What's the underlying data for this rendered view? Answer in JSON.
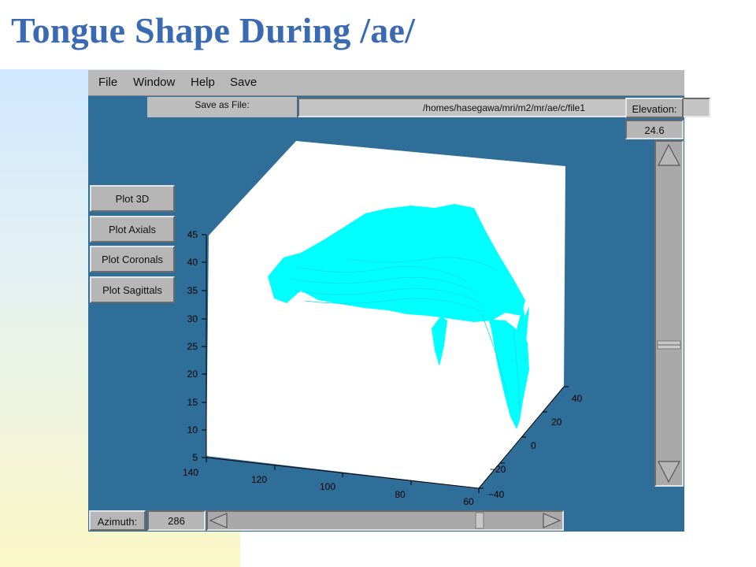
{
  "slide": {
    "title": "Tongue Shape During /ae/"
  },
  "menu": {
    "file": "File",
    "window": "Window",
    "help": "Help",
    "save": "Save"
  },
  "save_as": {
    "label": "Save as File:",
    "path": "/homes/hasegawa/mri/m2/mr/ae/c/file1"
  },
  "elevation": {
    "label": "Elevation:",
    "value": "24.6"
  },
  "azimuth": {
    "label": "Azimuth:",
    "value": "286"
  },
  "buttons": [
    "Plot 3D",
    "Plot Axials",
    "Plot Coronals",
    "Plot Sagittals"
  ],
  "axes": {
    "z_ticks": [
      "45",
      "40",
      "35",
      "30",
      "25",
      "20",
      "15",
      "10",
      "5"
    ],
    "x_ticks": [
      "140",
      "120",
      "100",
      "80",
      "60"
    ],
    "y_ticks": [
      "40",
      "20",
      "0",
      "−20",
      "−40"
    ]
  },
  "colors": {
    "background": "#306e9a",
    "surface": "#00ffff",
    "title": "#3a6ab4"
  },
  "scrollbars": {
    "elevation_position": 0.4,
    "azimuth_position": 0.8
  }
}
